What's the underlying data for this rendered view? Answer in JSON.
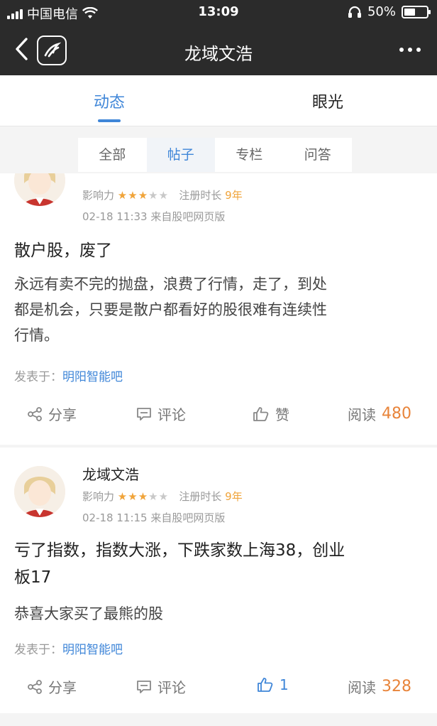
{
  "status_bar": {
    "carrier": "中国电信",
    "time": "13:09",
    "battery": "50%",
    "battery_level": 0.5
  },
  "nav": {
    "title": "龙域文浩"
  },
  "tabs": [
    {
      "label": "动态",
      "active": true
    },
    {
      "label": "眼光",
      "active": false
    }
  ],
  "subtabs": [
    {
      "label": "全部",
      "active": false
    },
    {
      "label": "帖子",
      "active": true
    },
    {
      "label": "专栏",
      "active": false
    },
    {
      "label": "问答",
      "active": false
    }
  ],
  "posts": [
    {
      "username": "",
      "influence_label": "影响力",
      "stars_filled": 3,
      "stars_total": 5,
      "reg_label": "注册时长",
      "reg_years": "9年",
      "time": "02-18 11:33",
      "source": "来自股吧网页版",
      "title": "散户股，废了",
      "body_lines": [
        "永远有卖不完的抛盘，浪费了行情，走了，到处",
        "都是机会，只要是散户都看好的股很难有连续性",
        "行情。"
      ],
      "posted_in_label": "发表于：",
      "posted_in": "明阳智能吧",
      "share": "分享",
      "comment": "评论",
      "like": "赞",
      "read_label": "阅读",
      "read_count": "480"
    },
    {
      "username": "龙域文浩",
      "influence_label": "影响力",
      "stars_filled": 3,
      "stars_total": 5,
      "reg_label": "注册时长",
      "reg_years": "9年",
      "time": "02-18 11:15",
      "source": "来自股吧网页版",
      "title_lines": [
        "亏了指数，指数大涨，下跌家数上海38，创业",
        "板17"
      ],
      "body_lines": [
        "恭喜大家买了最熊的股"
      ],
      "posted_in_label": "发表于：",
      "posted_in": "明阳智能吧",
      "share": "分享",
      "comment": "评论",
      "like": "1",
      "read_label": "阅读",
      "read_count": "328"
    }
  ]
}
